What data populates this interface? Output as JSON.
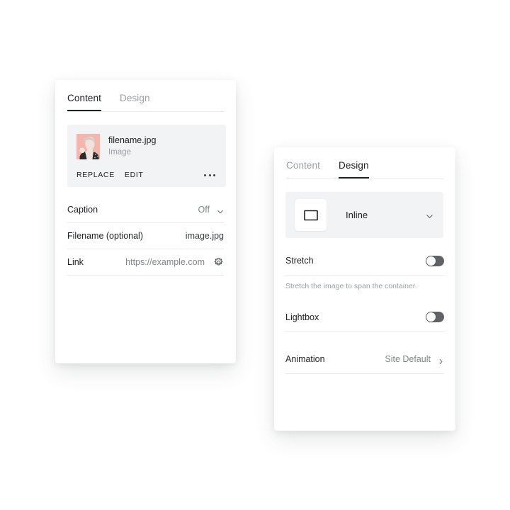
{
  "page": {
    "background": "#ffffff",
    "accent_dark": "#202124",
    "muted_text": "#80868b",
    "divider": "#e8eaed",
    "card_fill": "#f1f3f4",
    "thumb_bg": "#f4b6ac"
  },
  "content_panel": {
    "tabs": [
      {
        "label": "Content",
        "active": true
      },
      {
        "label": "Design",
        "active": false
      }
    ],
    "media": {
      "thumbnail_icon": "portrait-photo-thumbnail",
      "filename": "filename.jpg",
      "type_label": "Image",
      "replace_label": "REPLACE",
      "edit_label": "EDIT",
      "overflow_icon": "more-horizontal-icon"
    },
    "rows": [
      {
        "label": "Caption",
        "value": "Off",
        "control": "chevron-down-icon"
      },
      {
        "label": "Filename (optional)",
        "value": "image.jpg",
        "control": "none"
      },
      {
        "label": "Link",
        "value": "https://example.com",
        "control": "gear-icon"
      }
    ]
  },
  "design_panel": {
    "tabs": [
      {
        "label": "Content",
        "active": false
      },
      {
        "label": "Design",
        "active": true
      }
    ],
    "layout": {
      "icon": "inline-layout-icon",
      "value": "Inline",
      "control": "chevron-down-icon"
    },
    "rows": [
      {
        "label": "Stretch",
        "control": "toggle",
        "state": "off",
        "helper": "Stretch the image to span the container."
      },
      {
        "label": "Lightbox",
        "control": "toggle",
        "state": "off"
      },
      {
        "label": "Animation",
        "value": "Site Default",
        "control": "chevron-right-icon"
      }
    ]
  }
}
